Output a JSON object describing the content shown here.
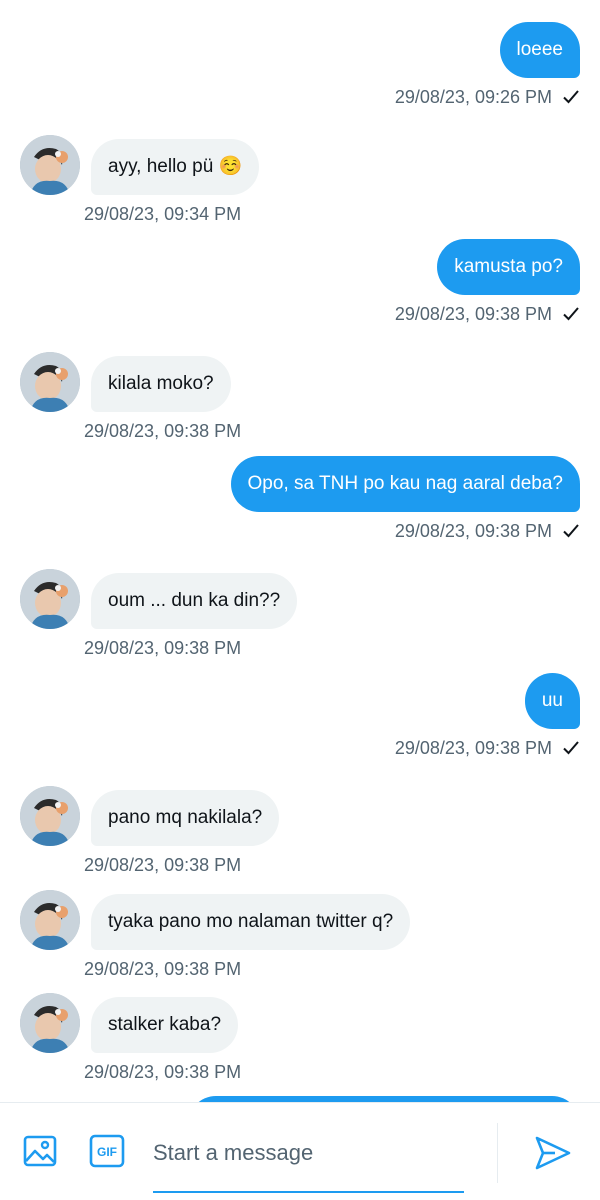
{
  "conversation": {
    "messages": [
      {
        "direction": "sent",
        "text": "loeee",
        "time": "29/08/23, 09:26 PM"
      },
      {
        "direction": "received",
        "text": "ayy, hello pü ☺️",
        "time": "29/08/23, 09:34 PM"
      },
      {
        "direction": "sent",
        "text": "kamusta po?",
        "time": "29/08/23, 09:38 PM"
      },
      {
        "direction": "received",
        "text": "kilala moko?",
        "time": "29/08/23, 09:38 PM"
      },
      {
        "direction": "sent",
        "text": "Opo, sa TNH po kau nag aaral deba?",
        "time": "29/08/23, 09:38 PM"
      },
      {
        "direction": "received",
        "text": "oum ... dun ka din??",
        "time": "29/08/23, 09:38 PM"
      },
      {
        "direction": "sent",
        "text": "uu",
        "time": "29/08/23, 09:38 PM"
      },
      {
        "direction": "received",
        "text": "pano mq nakilala?",
        "time": "29/08/23, 09:38 PM"
      },
      {
        "direction": "received",
        "text": "tyaka pano mo nalaman twitter q?",
        "time": "29/08/23, 09:38 PM"
      },
      {
        "direction": "received",
        "text": "stalker kaba?",
        "time": "29/08/23, 09:38 PM"
      }
    ]
  },
  "composer": {
    "placeholder": "Start a message",
    "gif_label": "GIF",
    "image_icon": "image-icon",
    "send_icon": "send-icon"
  },
  "colors": {
    "accent": "#1d9bf0",
    "received_bubble": "#eff3f4",
    "meta_text": "#536471"
  }
}
